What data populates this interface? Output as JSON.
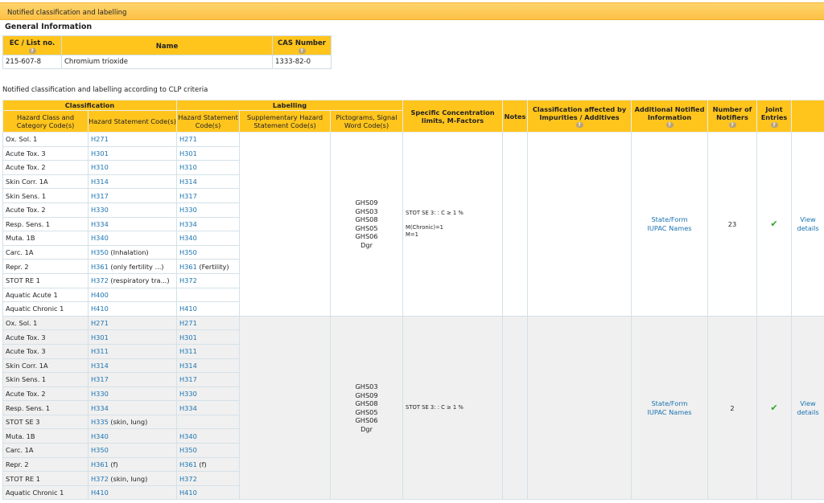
{
  "section_title": "Notified classification and labelling",
  "general": {
    "heading": "General Information",
    "headers": [
      "EC / List no.",
      "Name",
      "CAS Number"
    ],
    "row": [
      "215-607-8",
      "Chromium trioxide",
      "1333-82-0"
    ]
  },
  "criteria_label": "Notified classification and labelling according to CLP criteria",
  "table": {
    "group_classification": "Classification",
    "group_labelling": "Labelling",
    "h_hazard_class": "Hazard Class and Category Code(s)",
    "h_hazard_stmt": "Hazard Statement Code(s)",
    "h_label_stmt": "Hazard Statement Code(s)",
    "h_supp": "Supplementary Hazard Statement Code(s)",
    "h_pictograms": "Pictograms, Signal Word Code(s)",
    "h_conc": "Specific Concentration limits, M-Factors",
    "h_notes": "Notes",
    "h_affected": "Classification affected by Impurities / Additives",
    "h_additional": "Additional Notified Information",
    "h_notifiers": "Number of Notifiers",
    "h_joint": "Joint Entries"
  },
  "groups": [
    {
      "rows": [
        {
          "cls": "Ox. Sol. 1",
          "hs": "H271",
          "hs_note": "",
          "lb": "H271",
          "lb_note": ""
        },
        {
          "cls": "Acute Tox. 3",
          "hs": "H301",
          "hs_note": "",
          "lb": "H301",
          "lb_note": ""
        },
        {
          "cls": "Acute Tox. 2",
          "hs": "H310",
          "hs_note": "",
          "lb": "H310",
          "lb_note": ""
        },
        {
          "cls": "Skin Corr. 1A",
          "hs": "H314",
          "hs_note": "",
          "lb": "H314",
          "lb_note": ""
        },
        {
          "cls": "Skin Sens. 1",
          "hs": "H317",
          "hs_note": "",
          "lb": "H317",
          "lb_note": ""
        },
        {
          "cls": "Acute Tox. 2",
          "hs": "H330",
          "hs_note": "",
          "lb": "H330",
          "lb_note": ""
        },
        {
          "cls": "Resp. Sens. 1",
          "hs": "H334",
          "hs_note": "",
          "lb": "H334",
          "lb_note": ""
        },
        {
          "cls": "Muta. 1B",
          "hs": "H340",
          "hs_note": "",
          "lb": "H340",
          "lb_note": ""
        },
        {
          "cls": "Carc. 1A",
          "hs": "H350",
          "hs_note": "(Inhalation)",
          "lb": "H350",
          "lb_note": ""
        },
        {
          "cls": "Repr. 2",
          "hs": "H361",
          "hs_note": "(only fertility ...)",
          "lb": "H361",
          "lb_note": "(Fertility)"
        },
        {
          "cls": "STOT RE 1",
          "hs": "H372",
          "hs_note": "(respiratory tra...)",
          "lb": "H372",
          "lb_note": ""
        },
        {
          "cls": "Aquatic Acute 1",
          "hs": "H400",
          "hs_note": "",
          "lb": "",
          "lb_note": ""
        },
        {
          "cls": "Aquatic Chronic 1",
          "hs": "H410",
          "hs_note": "",
          "lb": "H410",
          "lb_note": ""
        }
      ],
      "pictograms": [
        "GHS09",
        "GHS03",
        "GHS08",
        "GHS05",
        "GHS06",
        "Dgr"
      ],
      "conc": [
        "STOT SE 3: : C ≥ 1 %",
        "",
        "M(Chronic)=1",
        "M=1"
      ],
      "additional": [
        "State/Form",
        "IUPAC Names"
      ],
      "notifiers": "23",
      "view": "View details"
    },
    {
      "rows": [
        {
          "cls": "Ox. Sol. 1",
          "hs": "H271",
          "hs_note": "",
          "lb": "H271",
          "lb_note": ""
        },
        {
          "cls": "Acute Tox. 3",
          "hs": "H301",
          "hs_note": "",
          "lb": "H301",
          "lb_note": ""
        },
        {
          "cls": "Acute Tox. 3",
          "hs": "H311",
          "hs_note": "",
          "lb": "H311",
          "lb_note": ""
        },
        {
          "cls": "Skin Corr. 1A",
          "hs": "H314",
          "hs_note": "",
          "lb": "H314",
          "lb_note": ""
        },
        {
          "cls": "Skin Sens. 1",
          "hs": "H317",
          "hs_note": "",
          "lb": "H317",
          "lb_note": ""
        },
        {
          "cls": "Acute Tox. 2",
          "hs": "H330",
          "hs_note": "",
          "lb": "H330",
          "lb_note": ""
        },
        {
          "cls": "Resp. Sens. 1",
          "hs": "H334",
          "hs_note": "",
          "lb": "H334",
          "lb_note": ""
        },
        {
          "cls": "STOT SE 3",
          "hs": "H335",
          "hs_note": "(skin, lung)",
          "lb": "",
          "lb_note": ""
        },
        {
          "cls": "Muta. 1B",
          "hs": "H340",
          "hs_note": "",
          "lb": "H340",
          "lb_note": ""
        },
        {
          "cls": "Carc. 1A",
          "hs": "H350",
          "hs_note": "",
          "lb": "H350",
          "lb_note": ""
        },
        {
          "cls": "Repr. 2",
          "hs": "H361",
          "hs_note": "(f)",
          "lb": "H361",
          "lb_note": "(f)"
        },
        {
          "cls": "STOT RE 1",
          "hs": "H372",
          "hs_note": "(skin, lung)",
          "lb": "H372",
          "lb_note": ""
        },
        {
          "cls": "Aquatic Chronic 1",
          "hs": "H410",
          "hs_note": "",
          "lb": "H410",
          "lb_note": ""
        }
      ],
      "pictograms": [
        "GHS03",
        "GHS09",
        "GHS08",
        "GHS05",
        "GHS06",
        "Dgr"
      ],
      "conc": [
        "STOT SE 3: : C ≥ 1 %"
      ],
      "additional": [
        "State/Form",
        "IUPAC Names"
      ],
      "notifiers": "2",
      "view": "View details"
    }
  ]
}
